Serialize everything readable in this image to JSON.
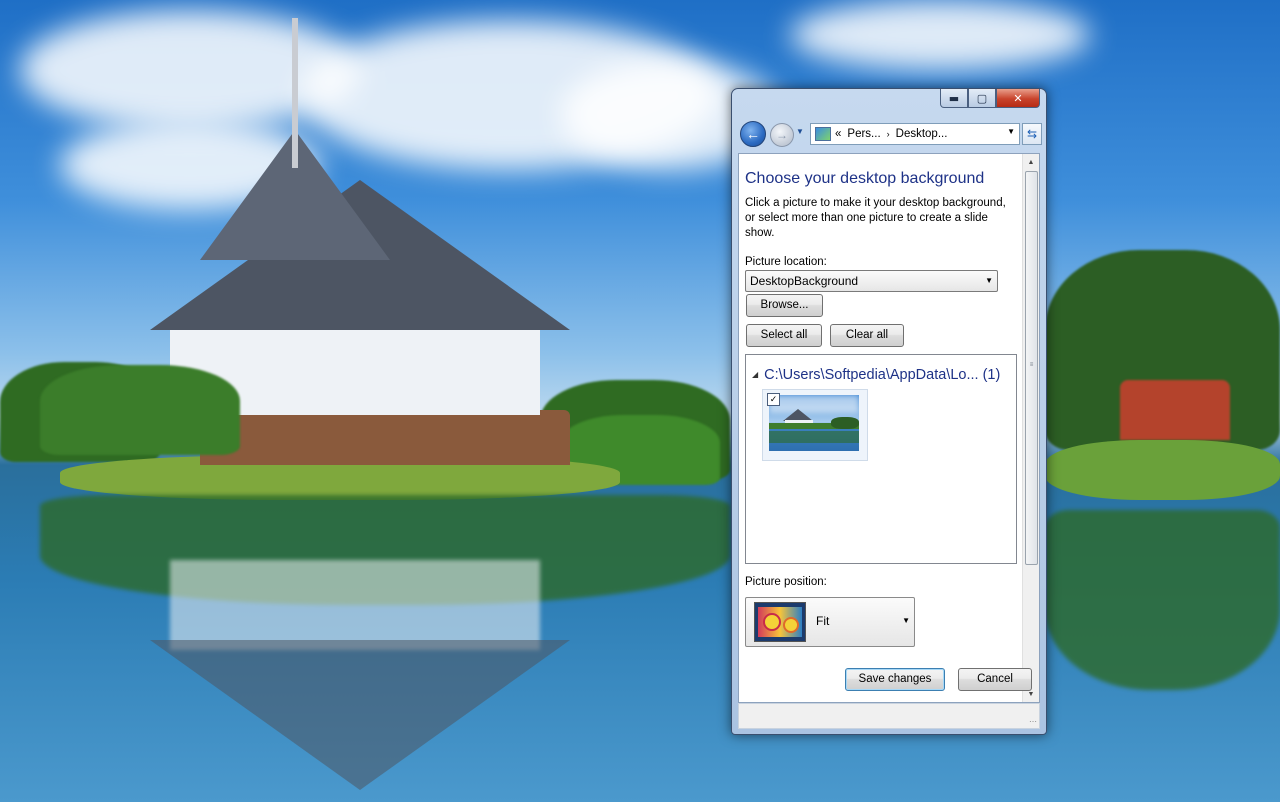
{
  "window": {
    "caption_buttons": {
      "minimize": "▬",
      "maximize": "▢",
      "close": "✕"
    },
    "address_bar": {
      "overflow": "«",
      "segments": [
        "Pers...",
        "Desktop..."
      ],
      "separator": "›",
      "icon": "control-panel-icon"
    },
    "icons": {
      "back": "arrow-left-icon",
      "forward": "arrow-right-icon",
      "refresh": "refresh-icon"
    }
  },
  "content": {
    "heading": "Choose your desktop background",
    "description": "Click a picture to make it your desktop background, or select more than one picture to create a slide show.",
    "picture_location_label": "Picture location:",
    "picture_location_value": "DesktopBackground",
    "browse_label": "Browse...",
    "select_all_label": "Select all",
    "clear_all_label": "Clear all",
    "folder": {
      "path": "C:\\Users\\Softpedia\\AppData\\Lo...",
      "count": "(1)",
      "thumbnails": [
        {
          "checked": true
        }
      ]
    },
    "picture_position_label": "Picture position:",
    "picture_position_value": "Fit",
    "save_label": "Save changes",
    "cancel_label": "Cancel"
  },
  "colors": {
    "heading": "#1e3287",
    "window_frame": "#b7cde7",
    "close_button": "#c8432b"
  }
}
